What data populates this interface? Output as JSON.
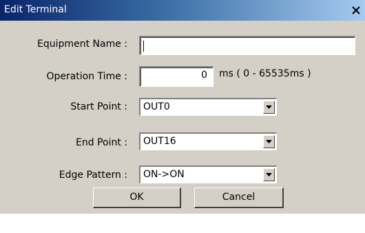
{
  "window": {
    "title": "Edit Terminal",
    "close_symbol": "×"
  },
  "form": {
    "equipment_name": {
      "label": "Equipment Name :",
      "value": ""
    },
    "operation_time": {
      "label": "Operation Time :",
      "value": "0",
      "unit": "ms ( 0 - 65535ms )"
    },
    "start_point": {
      "label": "Start Point :",
      "value": "OUT0"
    },
    "end_point": {
      "label": "End Point :",
      "value": "OUT16"
    },
    "edge_pattern": {
      "label": "Edge Pattern :",
      "value": "ON->ON"
    }
  },
  "buttons": {
    "ok": "OK",
    "cancel": "Cancel"
  },
  "colors": {
    "titlebar_start": "#0a246a",
    "titlebar_end": "#a6caf0",
    "dialog_bg": "#d4d0c8"
  },
  "icons": {
    "close": "close-icon",
    "dropdown": "chevron-down-icon"
  }
}
